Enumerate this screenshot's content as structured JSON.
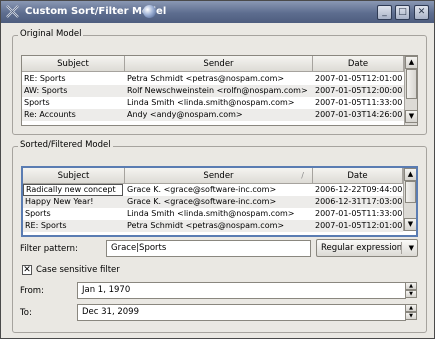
{
  "window": {
    "title": "Custom Sort/Filter Model",
    "buttons": {
      "minimize": "_",
      "maximize": "□",
      "close": "✕"
    }
  },
  "original": {
    "group_title": "Original Model",
    "columns": [
      "Subject",
      "Sender",
      "Date"
    ],
    "rows": [
      [
        "RE: Sports",
        "Petra Schmidt <petras@nospam.com>",
        "2007-01-05T12:01:00"
      ],
      [
        "AW: Sports",
        "Rolf Newschweinstein <rolfn@nospam.com>",
        "2007-01-05T12:00:00"
      ],
      [
        "Sports",
        "Linda Smith <linda.smith@nospam.com>",
        "2007-01-05T11:33:00"
      ],
      [
        "Re: Accounts",
        "Andy <andy@nospam.com>",
        "2007-01-03T14:26:00"
      ]
    ]
  },
  "sorted": {
    "group_title": "Sorted/Filtered Model",
    "columns": [
      "Subject",
      "Sender",
      "Date"
    ],
    "sort_indicator": "/",
    "rows": [
      [
        "Radically new concept",
        "Grace K. <grace@software-inc.com>",
        "2006-12-22T09:44:00"
      ],
      [
        "Happy New Year!",
        "Grace K. <grace@software-inc.com>",
        "2006-12-31T17:03:00"
      ],
      [
        "Sports",
        "Linda Smith <linda.smith@nospam.com>",
        "2007-01-05T11:33:00"
      ],
      [
        "RE: Sports",
        "Petra Schmidt <petras@nospam.com>",
        "2007-01-05T12:01:00"
      ]
    ]
  },
  "filter": {
    "label": "Filter pattern:",
    "value": "Grace|Sports",
    "syntax": "Regular expression"
  },
  "case_sensitive": {
    "label": "Case sensitive filter",
    "checked": true
  },
  "from": {
    "label": "From:",
    "value": "Jan 1, 1970"
  },
  "to": {
    "label": "To:",
    "value": "Dec 31, 2099"
  }
}
